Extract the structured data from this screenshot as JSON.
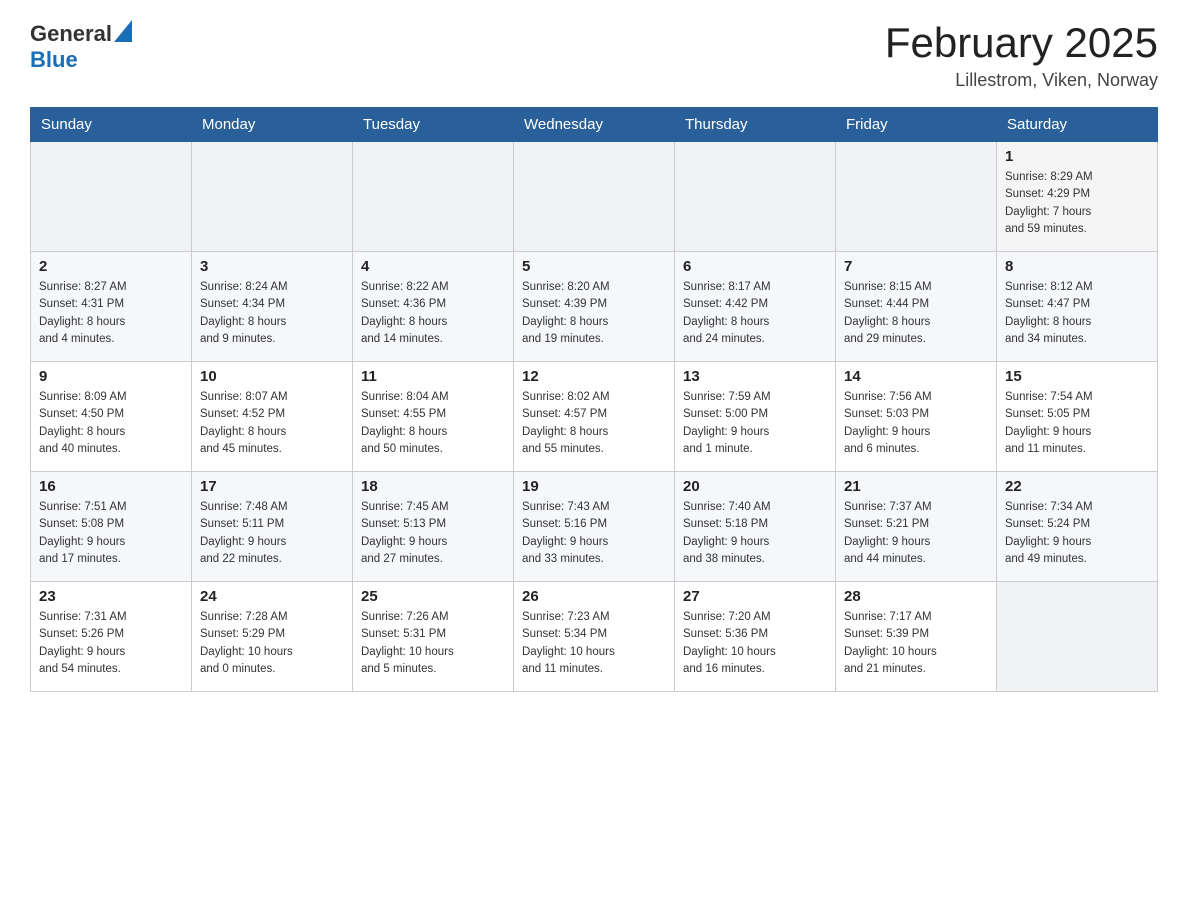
{
  "header": {
    "logo_general": "General",
    "logo_blue": "Blue",
    "month_title": "February 2025",
    "location": "Lillestrom, Viken, Norway"
  },
  "days_of_week": [
    "Sunday",
    "Monday",
    "Tuesday",
    "Wednesday",
    "Thursday",
    "Friday",
    "Saturday"
  ],
  "weeks": [
    [
      {
        "day": "",
        "info": ""
      },
      {
        "day": "",
        "info": ""
      },
      {
        "day": "",
        "info": ""
      },
      {
        "day": "",
        "info": ""
      },
      {
        "day": "",
        "info": ""
      },
      {
        "day": "",
        "info": ""
      },
      {
        "day": "1",
        "info": "Sunrise: 8:29 AM\nSunset: 4:29 PM\nDaylight: 7 hours\nand 59 minutes."
      }
    ],
    [
      {
        "day": "2",
        "info": "Sunrise: 8:27 AM\nSunset: 4:31 PM\nDaylight: 8 hours\nand 4 minutes."
      },
      {
        "day": "3",
        "info": "Sunrise: 8:24 AM\nSunset: 4:34 PM\nDaylight: 8 hours\nand 9 minutes."
      },
      {
        "day": "4",
        "info": "Sunrise: 8:22 AM\nSunset: 4:36 PM\nDaylight: 8 hours\nand 14 minutes."
      },
      {
        "day": "5",
        "info": "Sunrise: 8:20 AM\nSunset: 4:39 PM\nDaylight: 8 hours\nand 19 minutes."
      },
      {
        "day": "6",
        "info": "Sunrise: 8:17 AM\nSunset: 4:42 PM\nDaylight: 8 hours\nand 24 minutes."
      },
      {
        "day": "7",
        "info": "Sunrise: 8:15 AM\nSunset: 4:44 PM\nDaylight: 8 hours\nand 29 minutes."
      },
      {
        "day": "8",
        "info": "Sunrise: 8:12 AM\nSunset: 4:47 PM\nDaylight: 8 hours\nand 34 minutes."
      }
    ],
    [
      {
        "day": "9",
        "info": "Sunrise: 8:09 AM\nSunset: 4:50 PM\nDaylight: 8 hours\nand 40 minutes."
      },
      {
        "day": "10",
        "info": "Sunrise: 8:07 AM\nSunset: 4:52 PM\nDaylight: 8 hours\nand 45 minutes."
      },
      {
        "day": "11",
        "info": "Sunrise: 8:04 AM\nSunset: 4:55 PM\nDaylight: 8 hours\nand 50 minutes."
      },
      {
        "day": "12",
        "info": "Sunrise: 8:02 AM\nSunset: 4:57 PM\nDaylight: 8 hours\nand 55 minutes."
      },
      {
        "day": "13",
        "info": "Sunrise: 7:59 AM\nSunset: 5:00 PM\nDaylight: 9 hours\nand 1 minute."
      },
      {
        "day": "14",
        "info": "Sunrise: 7:56 AM\nSunset: 5:03 PM\nDaylight: 9 hours\nand 6 minutes."
      },
      {
        "day": "15",
        "info": "Sunrise: 7:54 AM\nSunset: 5:05 PM\nDaylight: 9 hours\nand 11 minutes."
      }
    ],
    [
      {
        "day": "16",
        "info": "Sunrise: 7:51 AM\nSunset: 5:08 PM\nDaylight: 9 hours\nand 17 minutes."
      },
      {
        "day": "17",
        "info": "Sunrise: 7:48 AM\nSunset: 5:11 PM\nDaylight: 9 hours\nand 22 minutes."
      },
      {
        "day": "18",
        "info": "Sunrise: 7:45 AM\nSunset: 5:13 PM\nDaylight: 9 hours\nand 27 minutes."
      },
      {
        "day": "19",
        "info": "Sunrise: 7:43 AM\nSunset: 5:16 PM\nDaylight: 9 hours\nand 33 minutes."
      },
      {
        "day": "20",
        "info": "Sunrise: 7:40 AM\nSunset: 5:18 PM\nDaylight: 9 hours\nand 38 minutes."
      },
      {
        "day": "21",
        "info": "Sunrise: 7:37 AM\nSunset: 5:21 PM\nDaylight: 9 hours\nand 44 minutes."
      },
      {
        "day": "22",
        "info": "Sunrise: 7:34 AM\nSunset: 5:24 PM\nDaylight: 9 hours\nand 49 minutes."
      }
    ],
    [
      {
        "day": "23",
        "info": "Sunrise: 7:31 AM\nSunset: 5:26 PM\nDaylight: 9 hours\nand 54 minutes."
      },
      {
        "day": "24",
        "info": "Sunrise: 7:28 AM\nSunset: 5:29 PM\nDaylight: 10 hours\nand 0 minutes."
      },
      {
        "day": "25",
        "info": "Sunrise: 7:26 AM\nSunset: 5:31 PM\nDaylight: 10 hours\nand 5 minutes."
      },
      {
        "day": "26",
        "info": "Sunrise: 7:23 AM\nSunset: 5:34 PM\nDaylight: 10 hours\nand 11 minutes."
      },
      {
        "day": "27",
        "info": "Sunrise: 7:20 AM\nSunset: 5:36 PM\nDaylight: 10 hours\nand 16 minutes."
      },
      {
        "day": "28",
        "info": "Sunrise: 7:17 AM\nSunset: 5:39 PM\nDaylight: 10 hours\nand 21 minutes."
      },
      {
        "day": "",
        "info": ""
      }
    ]
  ]
}
